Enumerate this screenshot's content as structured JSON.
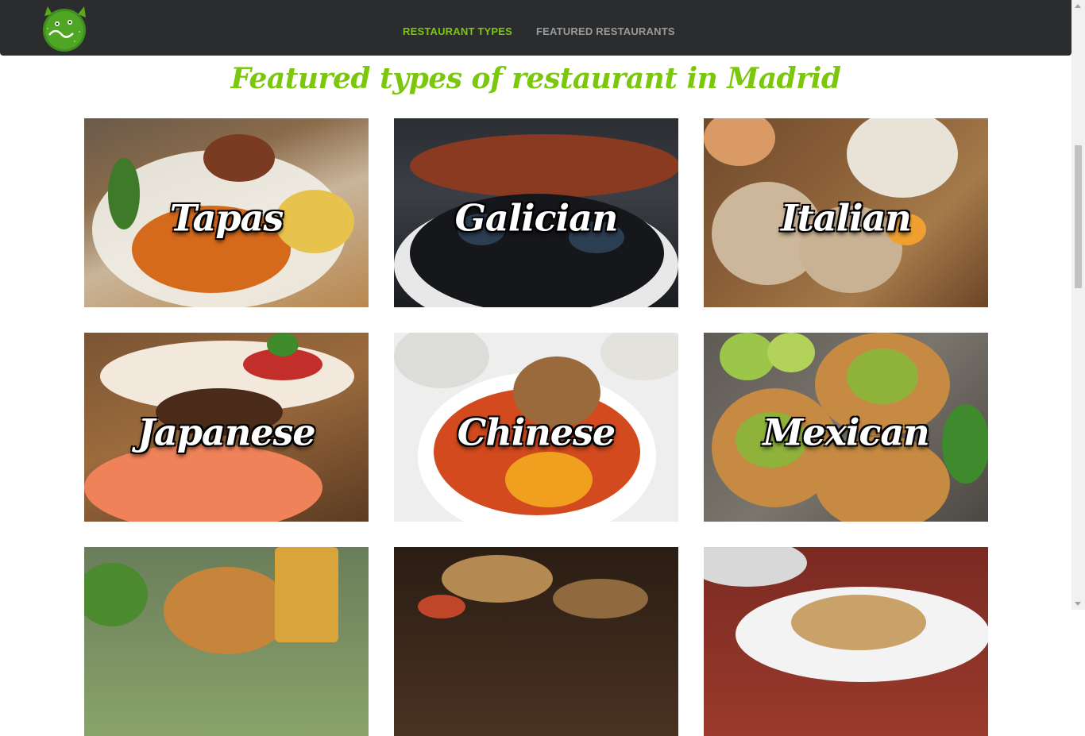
{
  "nav": {
    "logo_alt": "logo",
    "links": [
      {
        "label": "RESTAURANT TYPES",
        "active": true
      },
      {
        "label": "FEATURED RESTAURANTS",
        "active": false
      }
    ]
  },
  "page": {
    "title": "Featured types of restaurant in Madrid"
  },
  "cards": [
    {
      "label": "Tapas"
    },
    {
      "label": "Galician"
    },
    {
      "label": "Italian"
    },
    {
      "label": "Japanese"
    },
    {
      "label": "Chinese"
    },
    {
      "label": "Mexican"
    },
    {
      "label": ""
    },
    {
      "label": ""
    },
    {
      "label": ""
    }
  ],
  "colors": {
    "accent": "#7ac70c",
    "nav_bg": "#2b2c2e",
    "nav_inactive": "#9a9a9a"
  }
}
